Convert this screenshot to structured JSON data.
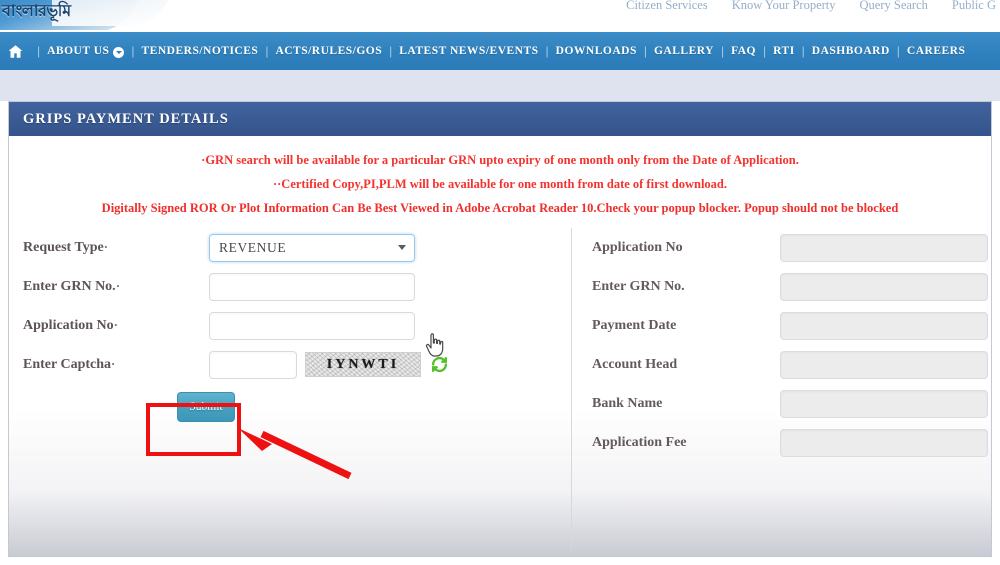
{
  "top_links": [
    {
      "label": "Citizen Services"
    },
    {
      "label": "Know Your Property"
    },
    {
      "label": "Query Search"
    },
    {
      "label": "Public G"
    }
  ],
  "branding": {
    "logo_text": "বাংলারভূমি"
  },
  "nav": {
    "home_icon": "home-icon",
    "separator": "|",
    "items": [
      {
        "label": "ABOUT US",
        "has_dropdown": true
      },
      {
        "label": "TENDERS/NOTICES",
        "has_dropdown": false
      },
      {
        "label": "ACTS/RULES/GOS",
        "has_dropdown": false
      },
      {
        "label": "LATEST NEWS/EVENTS",
        "has_dropdown": false
      },
      {
        "label": "DOWNLOADS",
        "has_dropdown": false
      },
      {
        "label": "GALLERY",
        "has_dropdown": false
      },
      {
        "label": "FAQ",
        "has_dropdown": false
      },
      {
        "label": "RTI",
        "has_dropdown": false
      },
      {
        "label": "DASHBOARD",
        "has_dropdown": false
      },
      {
        "label": "CAREERS",
        "has_dropdown": false
      }
    ]
  },
  "panel": {
    "title": "GRIPS PAYMENT DETAILS"
  },
  "notices": [
    "·GRN search will be available for a particular GRN upto expiry of one month only from the Date of Application.",
    "··Certified Copy,PI,PLM will be available for one month from date of first download.",
    "Digitally Signed ROR Or Plot Information Can Be Best Viewed in Adobe Acrobat Reader 10.Check your popup blocker. Popup should not be blocked"
  ],
  "form_left": {
    "request_type": {
      "label": "Request Type",
      "required_mark": "·",
      "value": "REVENUE",
      "options": [
        "REVENUE"
      ]
    },
    "grn_no": {
      "label": "Enter GRN No.",
      "required_mark": "·",
      "value": "",
      "placeholder": ""
    },
    "application_no": {
      "label": "Application No",
      "required_mark": "·",
      "value": "",
      "placeholder": ""
    },
    "captcha": {
      "label": "Enter Captcha",
      "required_mark": "·",
      "value": "",
      "placeholder": "",
      "image_text": "IYNWTI",
      "refresh_icon": "refresh-icon"
    },
    "submit_label": "Submit"
  },
  "form_right": {
    "fields": [
      {
        "label": "Application No",
        "value": ""
      },
      {
        "label": "Enter GRN No.",
        "value": ""
      },
      {
        "label": "Payment Date",
        "value": ""
      },
      {
        "label": "Account Head",
        "value": ""
      },
      {
        "label": "Bank Name",
        "value": ""
      },
      {
        "label": "Application Fee",
        "value": ""
      }
    ]
  },
  "annotations": {
    "highlight_target": "submit-button",
    "highlight_color": "#ee1111",
    "arrow_color": "#ee1111"
  },
  "cursor": {
    "type": "pointing-hand"
  },
  "colors": {
    "nav_blue": "#2f81bd",
    "panel_header_blue": "#3a5a93",
    "notice_red": "#f4322f",
    "submit_teal": "#45a0c0",
    "annotation_red": "#ee1111"
  }
}
